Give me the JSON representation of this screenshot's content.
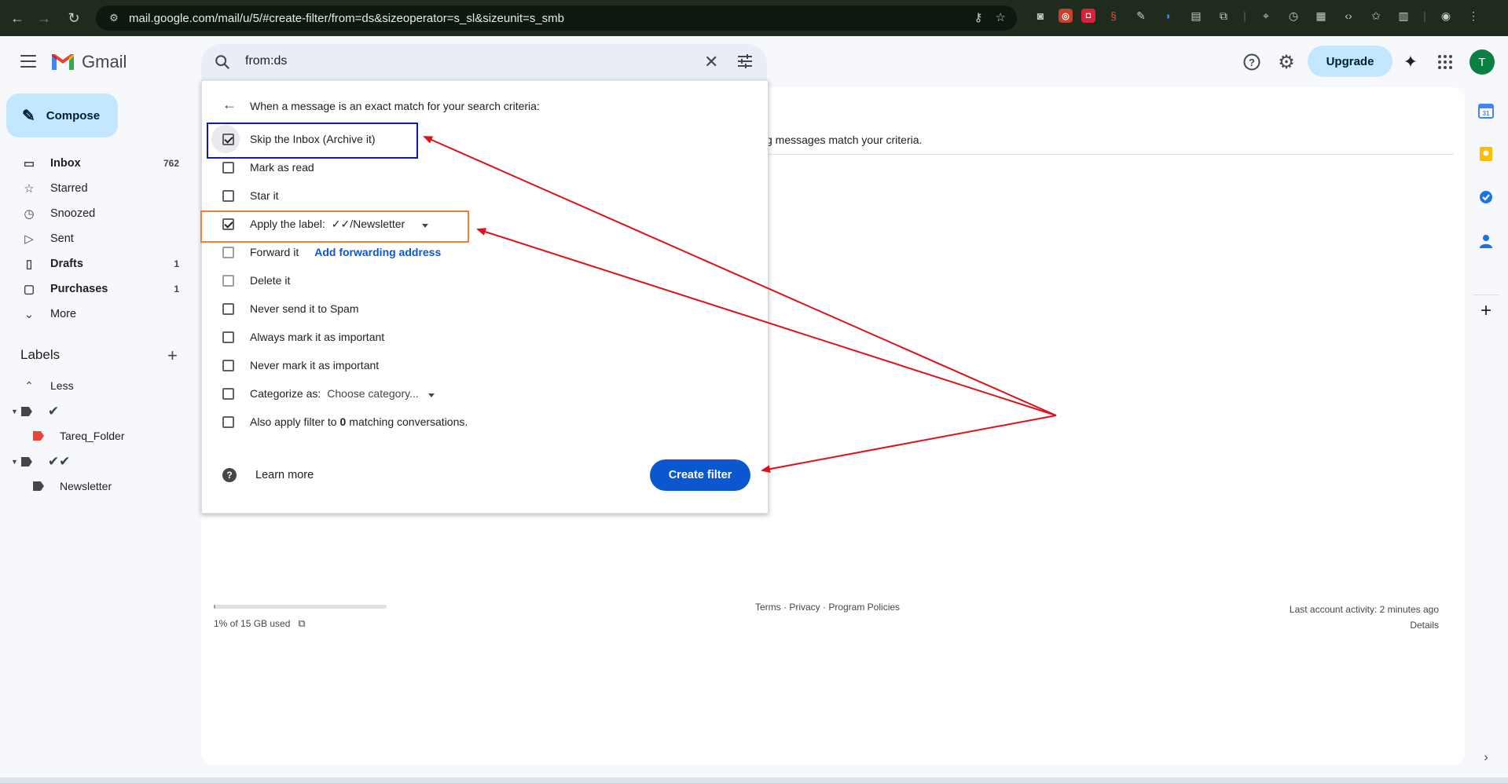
{
  "browser": {
    "url": "mail.google.com/mail/u/5/#create-filter/from=ds&sizeoperator=s_sl&sizeunit=s_smb"
  },
  "header": {
    "app_name": "Gmail",
    "search_query": "from:ds",
    "upgrade_label": "Upgrade",
    "avatar_initial": "T"
  },
  "sidebar": {
    "compose_label": "Compose",
    "items": [
      {
        "label": "Inbox",
        "count": "762",
        "icon": "inbox-icon"
      },
      {
        "label": "Starred",
        "count": "",
        "icon": "star-icon"
      },
      {
        "label": "Snoozed",
        "count": "",
        "icon": "clock-icon"
      },
      {
        "label": "Sent",
        "count": "",
        "icon": "send-icon"
      },
      {
        "label": "Drafts",
        "count": "1",
        "icon": "draft-icon"
      },
      {
        "label": "Purchases",
        "count": "1",
        "icon": "purchases-icon"
      },
      {
        "label": "More",
        "count": "",
        "icon": "chevron-down-icon"
      }
    ],
    "labels_heading": "Labels",
    "less_label": "Less",
    "labels": [
      {
        "name": "✔",
        "child": "Tareq_Folder"
      },
      {
        "name": "✔✔",
        "child": "Newsletter"
      }
    ]
  },
  "filter_dialog": {
    "heading": "When a message is an exact match for your search criteria:",
    "options": {
      "skip_inbox": "Skip the Inbox (Archive it)",
      "mark_read": "Mark as read",
      "star_it": "Star it",
      "apply_label": "Apply the label:",
      "apply_label_value": "✓✓/Newsletter",
      "forward_it": "Forward it",
      "add_forwarding": "Add forwarding address",
      "delete_it": "Delete it",
      "never_spam": "Never send it to Spam",
      "always_important": "Always mark it as important",
      "never_important": "Never mark it as important",
      "categorize_as": "Categorize as:",
      "categorize_value": "Choose category...",
      "also_apply_pre": "Also apply filter to",
      "also_apply_count": "0",
      "also_apply_post": "matching conversations."
    },
    "learn_more": "Learn more",
    "create_filter": "Create filter"
  },
  "main": {
    "partial_text": "g messages match your criteria.",
    "storage_text": "1% of 15 GB used",
    "storage_percent": 1,
    "footer_links": "Terms · Privacy · Program Policies",
    "last_activity": "Last account activity: 2 minutes ago",
    "details": "Details"
  },
  "colors": {
    "highlight_blue": "#0a18c7",
    "highlight_orange": "#f07f3c",
    "arrow_red": "#e0101a",
    "primary_button": "#0b57d0"
  }
}
